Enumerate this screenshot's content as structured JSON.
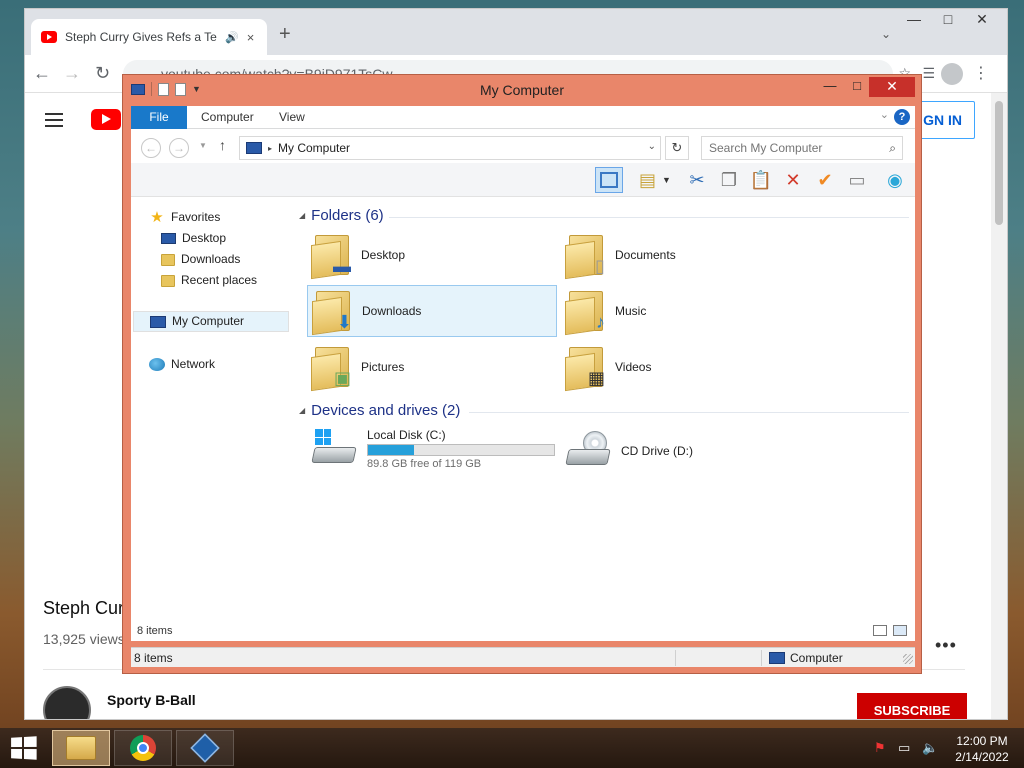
{
  "browser": {
    "tab_title": "Steph Curry Gives Refs a Tech",
    "tab_audio_icon": "speaker-icon",
    "tab_close": "×",
    "new_tab": "+",
    "tab_menu": "⌄",
    "minimize": "—",
    "maximize": "□",
    "close": "✕",
    "back": "←",
    "forward": "→",
    "reload": "↻",
    "url": "youtube.com/watch?v=B9jD971TsCw",
    "youtube": {
      "sign_in": "GN IN",
      "video_title": "Steph Cur",
      "views": "13,925 views",
      "more": "•••",
      "channel_name": "Sporty B-Ball",
      "subscribe": "SUBSCRIBE"
    }
  },
  "explorer": {
    "title": "My Computer",
    "window_buttons": {
      "minimize": "—",
      "maximize": "□",
      "close": "✕"
    },
    "ribbon_tabs": [
      "File",
      "Computer",
      "View"
    ],
    "help": "?",
    "address": {
      "location": "My Computer",
      "separator": "▸"
    },
    "search_placeholder": "Search My Computer",
    "nav": {
      "favorites_label": "Favorites",
      "favorites": [
        "Desktop",
        "Downloads",
        "Recent places"
      ],
      "computer_label": "My Computer",
      "network_label": "Network"
    },
    "groups": {
      "folders_label": "Folders (6)",
      "devices_label": "Devices and drives (2)"
    },
    "folders": [
      "Desktop",
      "Documents",
      "Downloads",
      "Music",
      "Pictures",
      "Videos"
    ],
    "drives": [
      {
        "name": "Local Disk (C:)",
        "free_text": "89.8 GB free of 119 GB",
        "used_fraction": 0.245
      },
      {
        "name": "CD Drive (D:)"
      }
    ],
    "item_count": "8 items",
    "status_count": "8 items",
    "status_location": "Computer"
  },
  "taskbar": {
    "time": "12:00 PM",
    "date": "2/14/2022"
  },
  "colors": {
    "explorer_frame": "#e9866a",
    "accent_blue": "#1979ca",
    "youtube_red": "#ff0000",
    "subscribe_red": "#cc0000"
  }
}
